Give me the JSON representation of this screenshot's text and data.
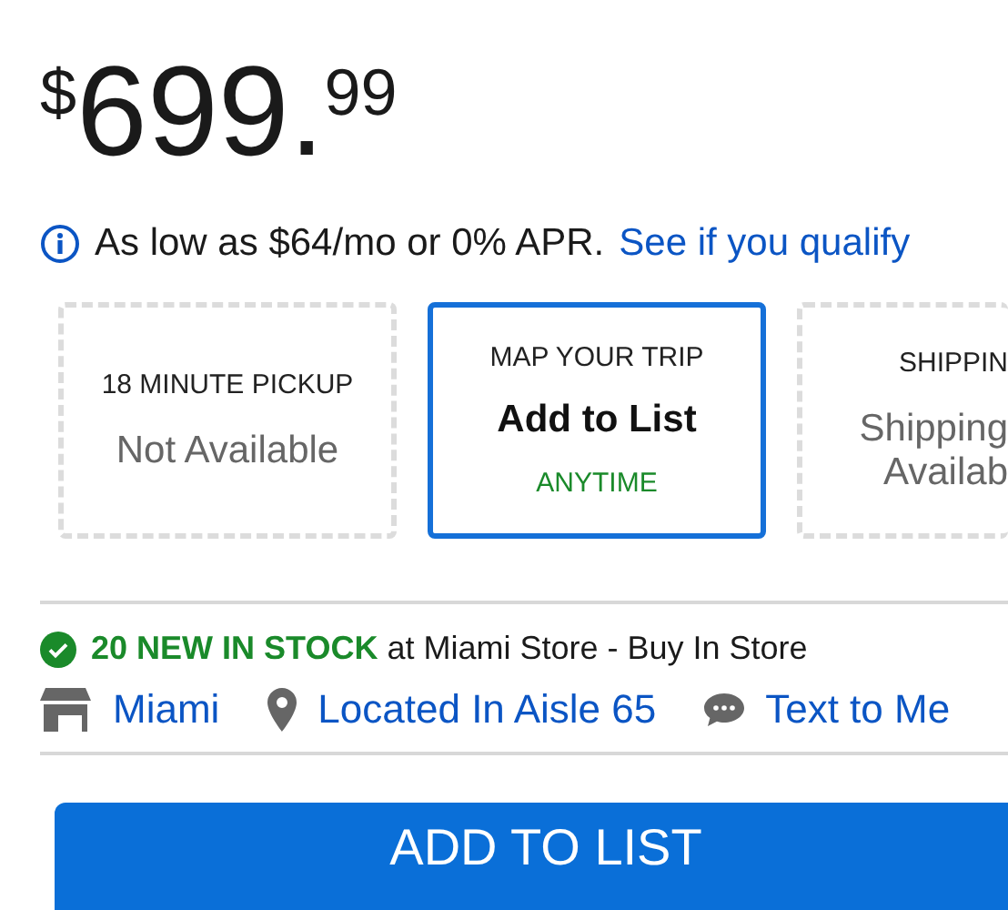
{
  "price": {
    "currency": "$",
    "whole": "699.",
    "cents": "99"
  },
  "financing": {
    "text": "As low as $64/mo or 0% APR.",
    "link": "See if you qualify"
  },
  "options": [
    {
      "label": "18 MINUTE PICKUP",
      "value": "Not Available",
      "selected": false
    },
    {
      "label": "MAP YOUR TRIP",
      "value": "Add to List",
      "note": "ANYTIME",
      "selected": true
    },
    {
      "label": "SHIPPIN",
      "value": "Shipping Availab",
      "selected": false
    }
  ],
  "stock": {
    "count": "20 NEW IN STOCK",
    "text": "at Miami Store - Buy In Store"
  },
  "links": [
    {
      "kind": "store",
      "label": "Miami"
    },
    {
      "kind": "pin",
      "label": "Located In Aisle 65"
    },
    {
      "kind": "chat",
      "label": "Text to Me"
    }
  ],
  "button": "ADD TO LIST"
}
